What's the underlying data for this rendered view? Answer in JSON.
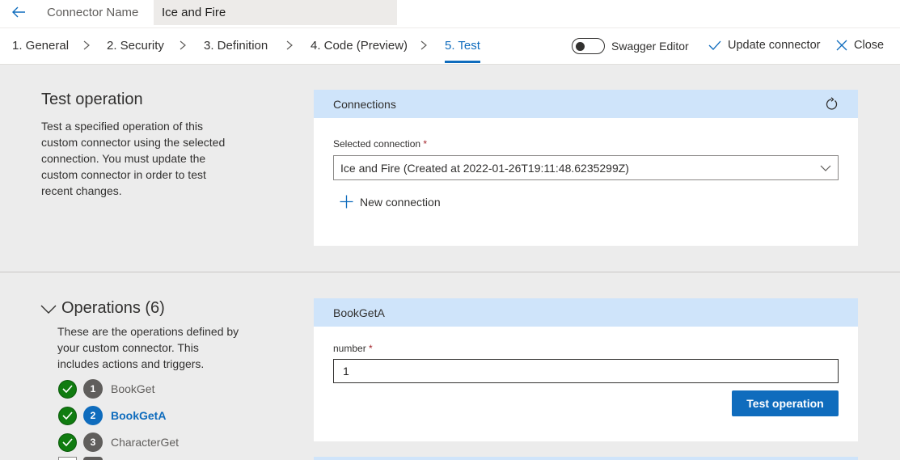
{
  "header": {
    "connector_name_label": "Connector Name",
    "connector_name_value": "Ice and Fire"
  },
  "steps": [
    {
      "label": "1. General",
      "active": false
    },
    {
      "label": "2. Security",
      "active": false
    },
    {
      "label": "3. Definition",
      "active": false
    },
    {
      "label": "4. Code (Preview)",
      "active": false
    },
    {
      "label": "5. Test",
      "active": true
    }
  ],
  "commands": {
    "swagger_editor_label": "Swagger Editor",
    "swagger_editor_on": false,
    "update_label": "Update connector",
    "close_label": "Close"
  },
  "test_section": {
    "title": "Test operation",
    "description": "Test a specified operation of this custom connector using the selected connection. You must update the custom connector in order to test recent changes."
  },
  "connections": {
    "title": "Connections",
    "selected_label": "Selected connection",
    "required_mark": "*",
    "selected_value": "Ice and Fire (Created at 2022-01-26T19:11:48.6235299Z)",
    "new_connection_label": "New connection"
  },
  "operations": {
    "title": "Operations (6)",
    "description": "These are the operations defined by your custom connector. This includes actions and triggers.",
    "items": [
      {
        "number": "1",
        "name": "BookGet",
        "active": false
      },
      {
        "number": "2",
        "name": "BookGetA",
        "active": true
      },
      {
        "number": "3",
        "name": "CharacterGet",
        "active": false
      }
    ]
  },
  "operation_panel": {
    "title": "BookGetA",
    "param_label": "number",
    "required_mark": "*",
    "param_value": "1",
    "test_button_label": "Test operation"
  },
  "colors": {
    "accent": "#0f6cbd",
    "success": "#107c10",
    "panel_header": "#cfe4fa",
    "page_background": "#ececec"
  }
}
